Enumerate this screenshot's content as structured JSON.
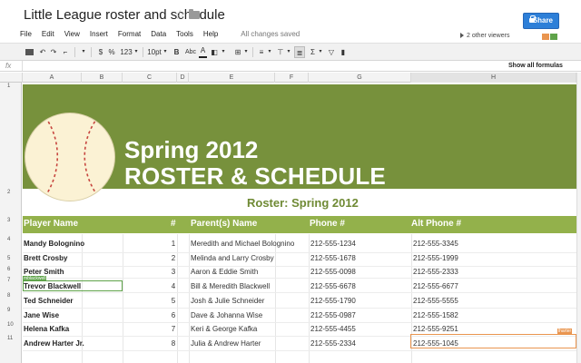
{
  "document": {
    "title": "Little League roster and schedule",
    "save_status": "All changes saved"
  },
  "share": {
    "label": "Share"
  },
  "menu": [
    "File",
    "Edit",
    "View",
    "Insert",
    "Format",
    "Data",
    "Tools",
    "Help"
  ],
  "viewers": {
    "label": "2 other viewers",
    "colors": [
      "#e9954f",
      "#5fa34a"
    ]
  },
  "toolbar": {
    "currency": "$",
    "percent": "%",
    "number_format": "123",
    "font_size": "10pt",
    "bold": "B",
    "abc": "Abc",
    "text_color": "A",
    "sum": "Σ"
  },
  "formula_bar": {
    "fx": "fx",
    "show_formulas": "Show all formulas"
  },
  "columns": [
    "A",
    "B",
    "C",
    "D",
    "E",
    "F",
    "G",
    "H"
  ],
  "rows": [
    "1",
    "2",
    "3",
    "4",
    "5",
    "6",
    "7",
    "8",
    "9",
    "10",
    "11"
  ],
  "banner": {
    "line1": "Spring 2012",
    "line2": "ROSTER & SCHEDULE",
    "color": "#77913c"
  },
  "subtitle": "Roster: Spring 2012",
  "table": {
    "headers": {
      "player": "Player Name",
      "number": "#",
      "parents": "Parent(s) Name",
      "phone": "Phone #",
      "alt_phone": "Alt Phone #"
    },
    "header_color": "#93b14b",
    "rows": [
      {
        "player": "Mandy Bolognino",
        "number": "1",
        "parents": "Meredith and Michael Bolognino",
        "phone": "212-555-1234",
        "alt_phone": "212-555-3345"
      },
      {
        "player": "Brett Crosby",
        "number": "2",
        "parents": "Melinda and Larry Crosby",
        "phone": "212-555-1678",
        "alt_phone": "212-555-1999"
      },
      {
        "player": "Peter Smith",
        "number": "3",
        "parents": "Aaron & Eddie Smith",
        "phone": "212-555-0098",
        "alt_phone": "212-555-2333"
      },
      {
        "player": "Trevor Blackwell",
        "number": "4",
        "parents": "Bill & Meredith Blackwell",
        "phone": "212-555-6678",
        "alt_phone": "212-555-6677"
      },
      {
        "player": "Ted Schneider",
        "number": "5",
        "parents": "Josh & Julie Schneider",
        "phone": "212-555-1790",
        "alt_phone": "212-555-5555"
      },
      {
        "player": "Jane Wise",
        "number": "6",
        "parents": "Dave & Johanna Wise",
        "phone": "212-555-0987",
        "alt_phone": "212-555-1582"
      },
      {
        "player": "Helena Kafka",
        "number": "7",
        "parents": "Keri & George Kafka",
        "phone": "212-555-4455",
        "alt_phone": "212-555-9251"
      },
      {
        "player": "Andrew Harter Jr.",
        "number": "8",
        "parents": "Julia & Andrew Harter",
        "phone": "212-555-2334",
        "alt_phone": "212-555-1045"
      }
    ]
  },
  "collaborators": {
    "green_tag": "mblackwell",
    "orange_tag": "lharter"
  }
}
